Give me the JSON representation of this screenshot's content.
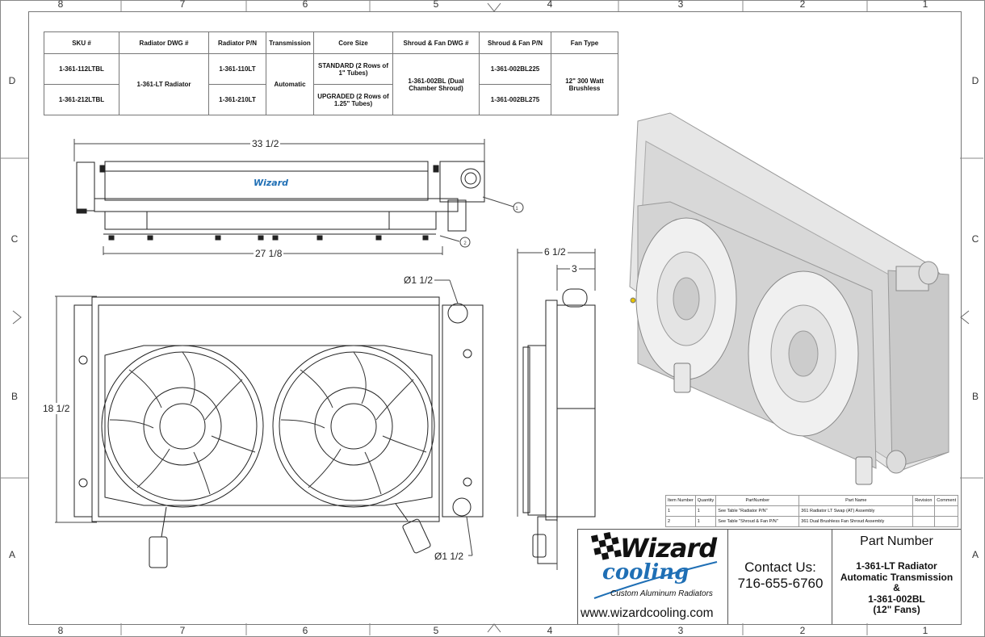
{
  "zones": {
    "top": [
      "8",
      "7",
      "6",
      "5",
      "4",
      "3",
      "2",
      "1"
    ],
    "side": [
      "D",
      "C",
      "B",
      "A"
    ]
  },
  "spec_table": {
    "headers": [
      "SKU #",
      "Radiator DWG #",
      "Radiator P/N",
      "Transmission",
      "Core Size",
      "Shroud & Fan DWG #",
      "Shroud & Fan P/N",
      "Fan Type"
    ],
    "sku": [
      "1-361-112LTBL",
      "1-361-212LTBL"
    ],
    "radiator_dwg": "1-361-LT Radiator",
    "radiator_pn": [
      "1-361-110LT",
      "1-361-210LT"
    ],
    "transmission": "Automatic",
    "core_size": [
      "STANDARD (2 Rows of 1\" Tubes)",
      "UPGRADED (2 Rows of 1.25\" Tubes)"
    ],
    "shroud_dwg": "1-361-002BL (Dual Chamber Shroud)",
    "shroud_pn": [
      "1-361-002BL225",
      "1-361-002BL275"
    ],
    "fan_type": "12\" 300 Watt Brushless"
  },
  "dimensions": {
    "overall_width": "33 1/2",
    "core_width": "27 1/8",
    "height": "18 1/2",
    "depth": "6 1/2",
    "shroud_depth": "3",
    "port_top": "Ø1 1/2",
    "port_bottom": "Ø1 1/2"
  },
  "balloons": [
    "1",
    "2"
  ],
  "bom": {
    "headers": [
      "Item Number",
      "Quantity",
      "PartNumber",
      "Part Name",
      "Revision",
      "Comment"
    ],
    "rows": [
      [
        "1",
        "1",
        "See Table \"Radiator P/N\"",
        "361 Radiator LT Swap (AT) Assembly",
        "",
        ""
      ],
      [
        "2",
        "1",
        "See Table \"Shroud & Fan P/N\"",
        "361 Dual Brushless Fan Shroud Assembly",
        "",
        ""
      ]
    ]
  },
  "title_block": {
    "logo_word": "Wizard",
    "logo_script": "cooling",
    "tagline": "Custom Aluminum Radiators",
    "website": "www.wizardcooling.com",
    "contact_label": "Contact Us:",
    "phone": "716-655-6760",
    "part_number_label": "Part Number",
    "part_lines": [
      "1-361-LT Radiator",
      "Automatic Transmission",
      "&",
      "1-361-002BL",
      "(12\" Fans)"
    ]
  },
  "colors": {
    "logo_blue": "#1f6fb5",
    "line": "#222222"
  }
}
